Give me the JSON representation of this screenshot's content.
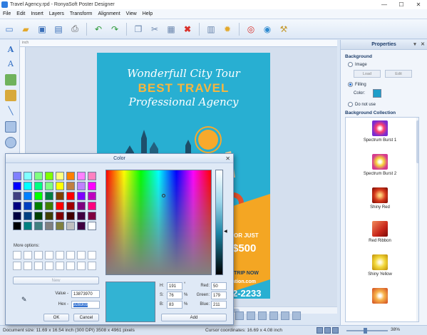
{
  "window": {
    "title": "Travel Agency.rpd - RonyaSoft Poster Designer",
    "min": "—",
    "max": "☐",
    "close": "✕"
  },
  "menu": [
    "File",
    "Edit",
    "Insert",
    "Layers",
    "Transform",
    "Alignment",
    "View",
    "Help"
  ],
  "toolbar": {
    "icons": [
      "new-icon",
      "open-icon",
      "save-icon",
      "save-as-icon",
      "print-icon",
      "undo-icon",
      "redo-icon",
      "copy-icon",
      "cut-icon",
      "paste-icon",
      "delete-icon",
      "page-setup-icon",
      "settings-icon",
      "help-icon",
      "web-icon",
      "tools-icon"
    ]
  },
  "ruler": {
    "unit": "inch"
  },
  "poster": {
    "line1": "Wonderfull City Tour",
    "line2": "BEST TRAVEL",
    "line3": "Professional Agency",
    "promo1": "OR JUST",
    "promo2": "$500",
    "promo3": "TRIP NOW",
    "promo4": "cation.com",
    "promo5": "2-2233"
  },
  "properties": {
    "title": "Properties",
    "background_label": "Background",
    "image_label": "Image",
    "load_label": "Load",
    "edit_label": "Edit",
    "filling_label": "Filling",
    "color_label": "Color:",
    "do_not_use_label": "Do not use",
    "collection_label": "Background Collection",
    "collection": [
      "Spectrum Burst 1",
      "Spectrum Burst 2",
      "Shiny Red",
      "Red Ribbon",
      "Shiny Yellow",
      ""
    ],
    "fill_color": "#1f9ec9"
  },
  "color_dialog": {
    "title": "Color",
    "more_options_label": "More options:",
    "new_label": "New",
    "value_label": "Value -",
    "value": "13873970",
    "hex_label": "Hex -",
    "hex": "328303",
    "ok_label": "OK",
    "cancel_label": "Cancel",
    "add_label": "Add",
    "h_label": "H:",
    "h": "191",
    "h_unit": "°",
    "s_label": "S:",
    "s": "76",
    "s_unit": "%",
    "b_label": "B:",
    "b": "83",
    "b_unit": "%",
    "red_label": "Red:",
    "red": "50",
    "green_label": "Green:",
    "green": "179",
    "blue_label": "Blue:",
    "blue": "211",
    "preview_color": "#32b3d3"
  },
  "status": {
    "document": "Document size: 11.69 x 16.54 inch (300 DPI) 3508 x 4961 pixels",
    "coords": "Cursor coordinates: 16.69 x 4.08 inch",
    "zoom": "38%"
  }
}
